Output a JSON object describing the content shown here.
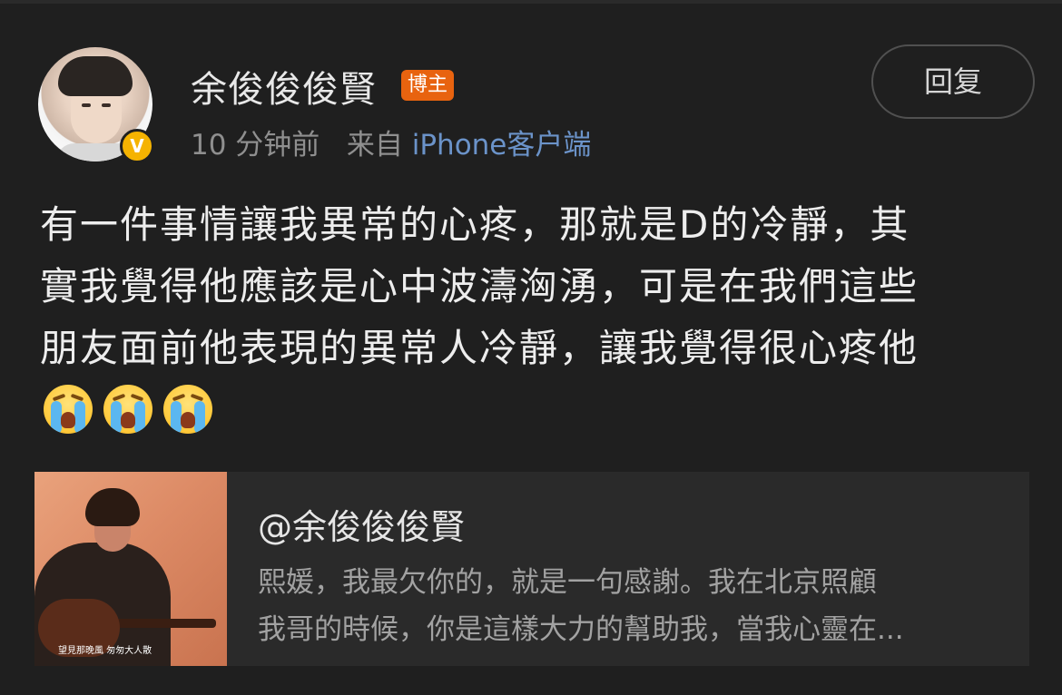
{
  "header": {
    "username": "余俊俊俊賢",
    "author_tag": "博主",
    "time": "10 分钟前",
    "source_prefix": "来自",
    "source_client": "iPhone客户端",
    "verified_mark": "V",
    "reply_label": "回复"
  },
  "post": {
    "lines": [
      "有一件事情讓我異常的心疼，那就是D的冷靜，其",
      "實我覺得他應該是心中波濤洶湧，可是在我們這些",
      "朋友面前他表現的異常人冷靜，讓我覺得很心疼他"
    ],
    "emojis": [
      "crying-face",
      "crying-face",
      "crying-face"
    ]
  },
  "quote": {
    "author": "@余俊俊俊賢",
    "excerpt_lines": [
      "熙媛，我最欠你的，就是一句感謝。我在北京照顧",
      "我哥的時候，你是這樣大力的幫助我，當我心靈在..."
    ],
    "thumbnail_caption": "望見那晚風 匆匆大人散"
  },
  "colors": {
    "background": "#1f1f1f",
    "author_tag_bg": "#e8630f",
    "verified_badge": "#f5b301",
    "client_link": "#6b93c9",
    "card_bg": "#2a2a2a"
  }
}
